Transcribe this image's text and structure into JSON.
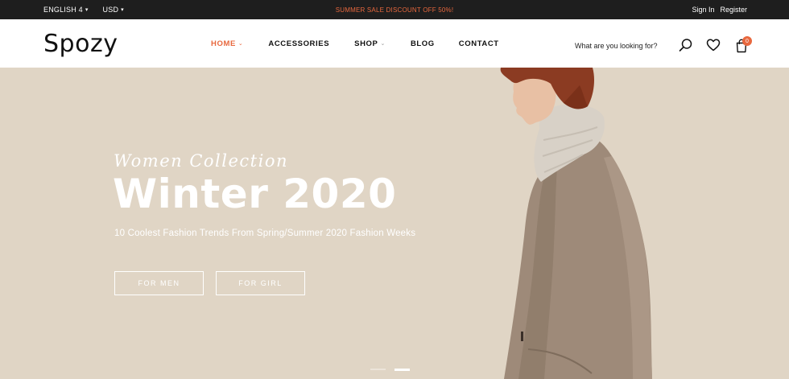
{
  "topbar": {
    "language": "ENGLISH 4",
    "currency": "USD",
    "promo": "SUMMER SALE DISCOUNT OFF 50%!",
    "sign_in": "Sign In",
    "register": "Register"
  },
  "header": {
    "logo": "Spozy",
    "nav": [
      {
        "label": "HOME",
        "active": true,
        "has_dropdown": true
      },
      {
        "label": "ACCESSORIES",
        "active": false,
        "has_dropdown": false
      },
      {
        "label": "SHOP",
        "active": false,
        "has_dropdown": true
      },
      {
        "label": "BLOG",
        "active": false,
        "has_dropdown": false
      },
      {
        "label": "CONTACT",
        "active": false,
        "has_dropdown": false
      }
    ],
    "search_prompt": "What are you looking for?",
    "cart_count": "0",
    "icons": [
      "search-icon",
      "heart-icon",
      "shopping-bag-icon"
    ]
  },
  "hero": {
    "script_title": "Women Collection",
    "headline": "Winter 2020",
    "tagline": "10 Coolest Fashion Trends From Spring/Summer 2020 Fashion Weeks",
    "button_men": "FOR MEN",
    "button_girl": "FOR GIRL",
    "slides_total": 2,
    "slide_active": 2
  },
  "colors": {
    "accent": "#e8683e",
    "topbar_bg": "#1e1e1e",
    "hero_bg": "#e0d5c5"
  }
}
